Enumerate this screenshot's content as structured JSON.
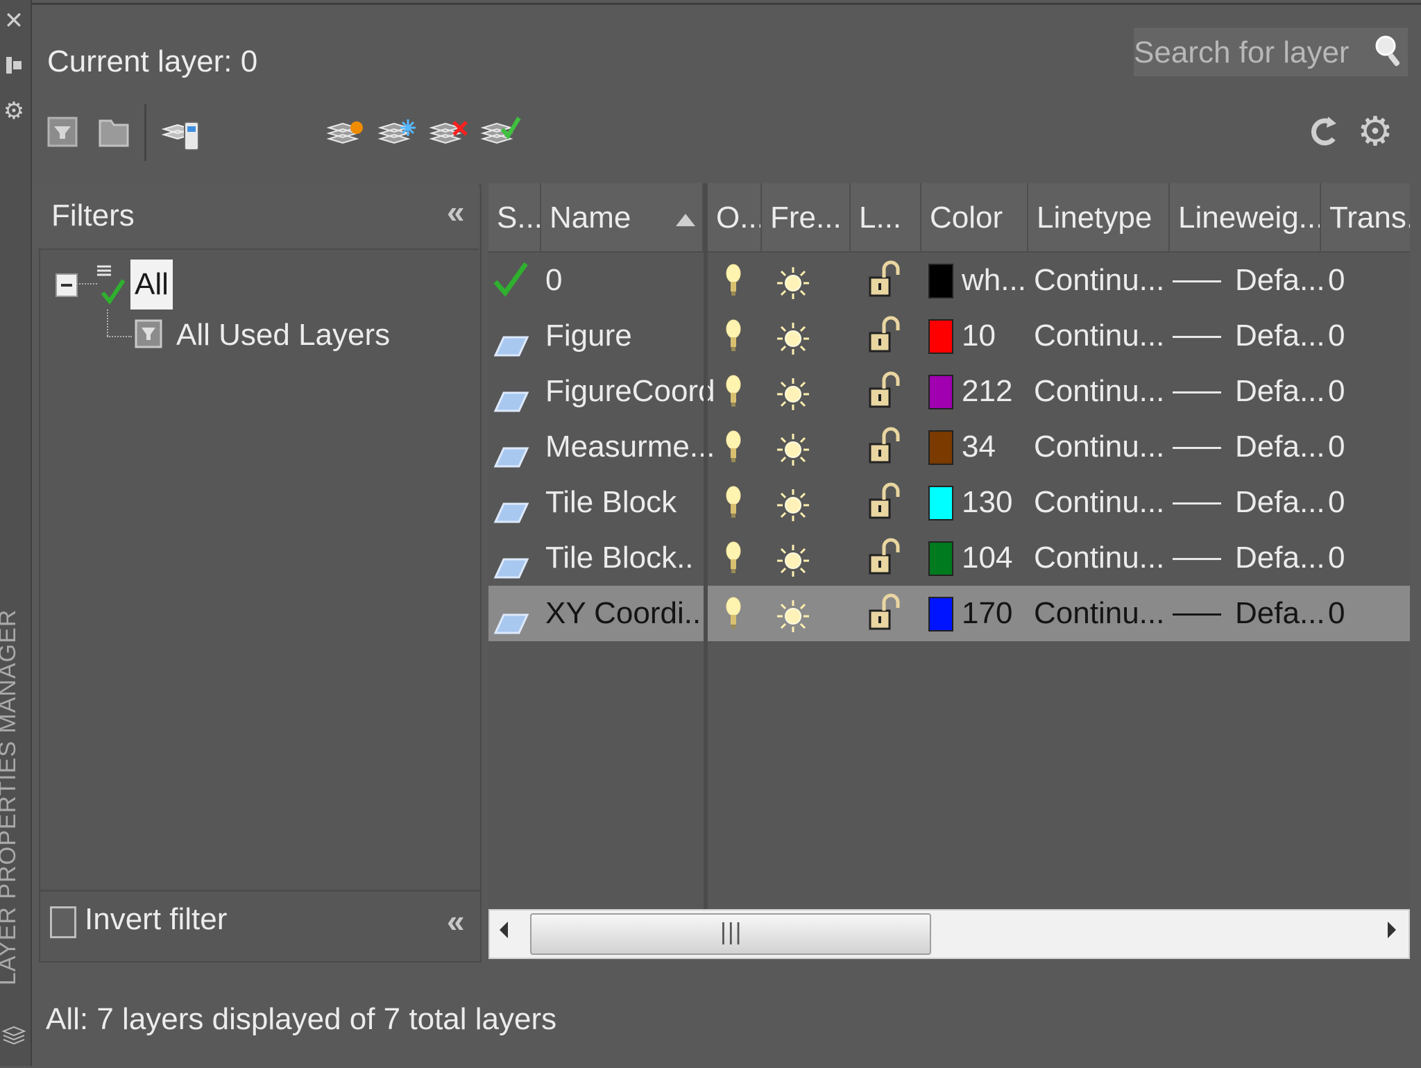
{
  "dock": {
    "title": "LAYER PROPERTIES MANAGER"
  },
  "header": {
    "current_layer_label": "Current layer: 0"
  },
  "search": {
    "placeholder": "Search for layer"
  },
  "filters": {
    "title": "Filters",
    "tree_root": "All",
    "tree_child": "All Used Layers",
    "invert_label": "Invert filter"
  },
  "columns": {
    "status": "S...",
    "name": "Name",
    "on": "O...",
    "freeze": "Fre...",
    "lock": "L...",
    "color": "Color",
    "linetype": "Linetype",
    "lineweight": "Lineweig...",
    "transparency": "Trans..."
  },
  "layers": [
    {
      "name": "0",
      "color_label": "wh...",
      "color_hex": "#000000",
      "linetype": "Continu...",
      "lineweight": "Defa...",
      "transparency": "0",
      "current": true
    },
    {
      "name": "Figure",
      "color_label": "10",
      "color_hex": "#ff0000",
      "linetype": "Continu...",
      "lineweight": "Defa...",
      "transparency": "0"
    },
    {
      "name": "FigureCoord",
      "color_label": "212",
      "color_hex": "#a000b0",
      "linetype": "Continu...",
      "lineweight": "Defa...",
      "transparency": "0"
    },
    {
      "name": "Measurme...",
      "color_label": "34",
      "color_hex": "#7a3a00",
      "linetype": "Continu...",
      "lineweight": "Defa...",
      "transparency": "0"
    },
    {
      "name": "Tile Block",
      "color_label": "130",
      "color_hex": "#00ffff",
      "linetype": "Continu...",
      "lineweight": "Defa...",
      "transparency": "0"
    },
    {
      "name": "Tile Block..",
      "color_label": "104",
      "color_hex": "#007a1e",
      "linetype": "Continu...",
      "lineweight": "Defa...",
      "transparency": "0"
    },
    {
      "name": "XY Coordi...",
      "color_label": "170",
      "color_hex": "#0014ff",
      "linetype": "Continu...",
      "lineweight": "Defa...",
      "transparency": "0",
      "selected": true
    }
  ],
  "status": {
    "text": "All: 7 layers displayed of 7 total layers"
  },
  "icons": {
    "dock": [
      "close-icon",
      "pin-icon",
      "gear-icon"
    ],
    "toolbar": [
      "new-property-filter-icon",
      "new-group-filter-icon",
      "layer-states-icon",
      "new-layer-icon",
      "new-layer-vp-frozen-icon",
      "delete-layer-icon",
      "set-current-icon",
      "refresh-icon",
      "settings-icon"
    ]
  }
}
